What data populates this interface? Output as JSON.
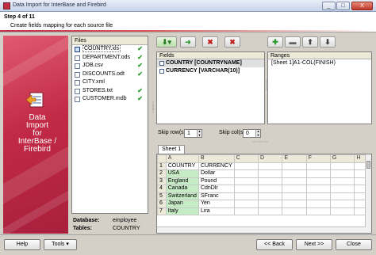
{
  "window": {
    "title": "Data Import for InterBase and Firebird",
    "controls": [
      "_",
      "□",
      "X"
    ]
  },
  "header": {
    "step": "Step 4 of 11",
    "subtitle": "Create fields mapping for each source file"
  },
  "banner": {
    "line1": "Data",
    "line2": "Import",
    "line3": "for",
    "line4": "InterBase /",
    "line5": "Firebird"
  },
  "files": {
    "header": "Files",
    "items": [
      {
        "label": "COUNTRY.xls",
        "done": "✔"
      },
      {
        "label": "DEPARTMENT.ods",
        "done": "✔"
      },
      {
        "label": "JOB.csv",
        "done": "✔"
      },
      {
        "label": "DISCOUNTS.odt",
        "done": "✔"
      },
      {
        "label": "CITY.xml",
        "done": ""
      },
      {
        "label": "STORES.txt",
        "done": "✔"
      },
      {
        "label": "CUSTOMER.mdb",
        "done": "✔"
      }
    ]
  },
  "dbinfo": {
    "database_label": "Database:",
    "database_value": "employee",
    "tables_label": "Tables:",
    "tables_value": "COUNTRY"
  },
  "fields": {
    "header": "Fields",
    "items": [
      {
        "label": "COUNTRY [COUNTRYNAME]"
      },
      {
        "label": "CURRENCY [VARCHAR(10)]"
      }
    ]
  },
  "ranges": {
    "header": "Ranges",
    "items": [
      {
        "label": "[Sheet 1]A1-COL(FINISH)"
      }
    ]
  },
  "skip": {
    "rows_label": "Skip row(s)",
    "rows_value": "1",
    "cols_label": "Skip col(s)",
    "cols_value": "0"
  },
  "sheet": {
    "tab": "Sheet 1",
    "columns": [
      "A",
      "B",
      "C",
      "D",
      "E",
      "F",
      "G",
      "H"
    ],
    "rows": [
      {
        "n": "1",
        "a": "COUNTRY",
        "b": "CURRENCY"
      },
      {
        "n": "2",
        "a": "USA",
        "b": "Dollar"
      },
      {
        "n": "3",
        "a": "England",
        "b": "Pound"
      },
      {
        "n": "4",
        "a": "Canada",
        "b": "CdnDlr"
      },
      {
        "n": "5",
        "a": "Switzerland",
        "b": "SFranc"
      },
      {
        "n": "6",
        "a": "Japan",
        "b": "Yen"
      },
      {
        "n": "7",
        "a": "Italy",
        "b": "Lira"
      }
    ]
  },
  "buttons": {
    "help": "Help",
    "tools": "Tools",
    "back": "<< Back",
    "next": "Next >>",
    "close": "Close"
  },
  "colors": {
    "accent": "#c22a46",
    "check": "#2a9a2a",
    "mapped_cell": "#c6ecc6"
  }
}
